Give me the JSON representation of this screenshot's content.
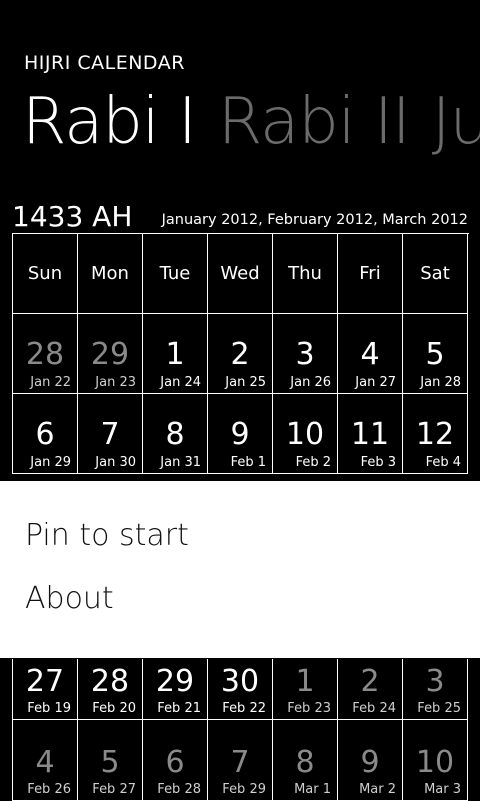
{
  "app": {
    "title": "HIJRI CALENDAR"
  },
  "pivot": {
    "items": [
      "Rabi I",
      "Rabi II",
      "Ju"
    ]
  },
  "header": {
    "year": "1433 AH",
    "gregorian_months": "January 2012, February 2012, March 2012"
  },
  "calendar": {
    "weekdays": [
      "Sun",
      "Mon",
      "Tue",
      "Wed",
      "Thu",
      "Fri",
      "Sat"
    ],
    "rows": [
      [
        {
          "day": "28",
          "g": "Jan 22",
          "dim": true
        },
        {
          "day": "29",
          "g": "Jan 23",
          "dim": true
        },
        {
          "day": "1",
          "g": "Jan 24",
          "dim": false
        },
        {
          "day": "2",
          "g": "Jan 25",
          "dim": false
        },
        {
          "day": "3",
          "g": "Jan 26",
          "dim": false
        },
        {
          "day": "4",
          "g": "Jan 27",
          "dim": false
        },
        {
          "day": "5",
          "g": "Jan 28",
          "dim": false
        }
      ],
      [
        {
          "day": "6",
          "g": "Jan 29",
          "dim": false
        },
        {
          "day": "7",
          "g": "Jan 30",
          "dim": false
        },
        {
          "day": "8",
          "g": "Jan 31",
          "dim": false
        },
        {
          "day": "9",
          "g": "Feb 1",
          "dim": false
        },
        {
          "day": "10",
          "g": "Feb 2",
          "dim": false
        },
        {
          "day": "11",
          "g": "Feb 3",
          "dim": false
        },
        {
          "day": "12",
          "g": "Feb 4",
          "dim": false
        }
      ]
    ],
    "bottom_rows": [
      [
        {
          "day": "27",
          "g": "Feb 19",
          "dim": false
        },
        {
          "day": "28",
          "g": "Feb 20",
          "dim": false
        },
        {
          "day": "29",
          "g": "Feb 21",
          "dim": false
        },
        {
          "day": "30",
          "g": "Feb 22",
          "dim": false
        },
        {
          "day": "1",
          "g": "Feb 23",
          "dim": true
        },
        {
          "day": "2",
          "g": "Feb 24",
          "dim": true
        },
        {
          "day": "3",
          "g": "Feb 25",
          "dim": true
        }
      ],
      [
        {
          "day": "4",
          "g": "Feb 26",
          "dim": true
        },
        {
          "day": "5",
          "g": "Feb 27",
          "dim": true
        },
        {
          "day": "6",
          "g": "Feb 28",
          "dim": true
        },
        {
          "day": "7",
          "g": "Feb 29",
          "dim": true
        },
        {
          "day": "8",
          "g": "Mar 1",
          "dim": true
        },
        {
          "day": "9",
          "g": "Mar 2",
          "dim": true
        },
        {
          "day": "10",
          "g": "Mar 3",
          "dim": true
        }
      ]
    ]
  },
  "menu": {
    "items": [
      "Pin to start",
      "About"
    ]
  }
}
